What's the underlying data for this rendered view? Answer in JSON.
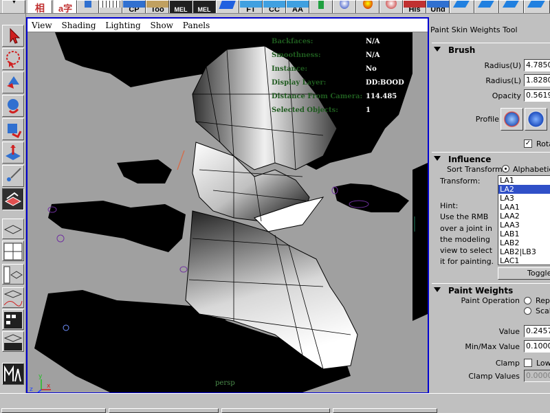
{
  "shelf": {
    "buttons": [
      {
        "label": "",
        "icon": "kanji-icon"
      },
      {
        "label": "",
        "icon": "kana-icon"
      },
      {
        "label": "",
        "icon": "pin-icon"
      },
      {
        "label": "",
        "icon": "grid-icon"
      },
      {
        "label": "CP",
        "icon": "cp-icon"
      },
      {
        "label": "Too",
        "icon": "tool-icon"
      },
      {
        "label": "",
        "icon": "mel-icon-1"
      },
      {
        "label": "",
        "icon": "mel-icon-2"
      },
      {
        "label": "",
        "icon": "blue-shape-icon"
      },
      {
        "label": "FT",
        "icon": "ft-icon"
      },
      {
        "label": "CC",
        "icon": "cc-icon"
      },
      {
        "label": "AA",
        "icon": "aa-icon"
      },
      {
        "label": "",
        "icon": "joint-icon"
      },
      {
        "label": "",
        "icon": "sphere-icon"
      },
      {
        "label": "",
        "icon": "paint-icon"
      },
      {
        "label": "",
        "icon": "red-sphere-icon"
      },
      {
        "label": "His",
        "icon": "history-icon"
      },
      {
        "label": "Und",
        "icon": "undo-icon"
      },
      {
        "label": "",
        "icon": "plane-icon-1"
      },
      {
        "label": "",
        "icon": "plane-icon-2"
      },
      {
        "label": "",
        "icon": "plane-icon-3"
      },
      {
        "label": "",
        "icon": "plane-icon-4"
      }
    ]
  },
  "viewport": {
    "menu": [
      "View",
      "Shading",
      "Lighting",
      "Show",
      "Panels"
    ],
    "hud": [
      {
        "key": "Backfaces:",
        "value": "N/A"
      },
      {
        "key": "Smoothness:",
        "value": "N/A"
      },
      {
        "key": "Instance:",
        "value": "No"
      },
      {
        "key": "Display Layer:",
        "value": "DD:BOOD"
      },
      {
        "key": "Distance From Camera:",
        "value": "114.485"
      },
      {
        "key": "Selected Objects:",
        "value": "1"
      }
    ],
    "camera": "persp",
    "axis": {
      "x": "x",
      "y": "y",
      "z": "z"
    }
  },
  "panel": {
    "title": "Paint Skin Weights Tool",
    "brush": {
      "header": "Brush",
      "radius_u_label": "Radius(U)",
      "radius_u": "4.7850",
      "radius_l_label": "Radius(L)",
      "radius_l": "1.8280",
      "opacity_label": "Opacity",
      "opacity": "0.5619",
      "profile_label": "Profile",
      "rotate_label": "Rota",
      "rotate_checked": true
    },
    "influence": {
      "header": "Influence",
      "sort_label": "Sort Transforms",
      "sort_option": "Alphabetica",
      "transform_label": "Transform:",
      "hint": [
        "Hint:",
        "Use the RMB",
        "over a joint in",
        "the modeling",
        "view to select",
        "it for painting."
      ],
      "items": [
        "LA1",
        "LA2",
        "LA3",
        "LAA1",
        "LAA2",
        "LAA3",
        "LAB1",
        "LAB2",
        "LAB2|LB3",
        "LAC1"
      ],
      "selected": "LA2",
      "toggle_label": "Toggle"
    },
    "paint_weights": {
      "header": "Paint Weights",
      "operation_label": "Paint Operation",
      "op_replace": "Rep",
      "op_scale": "Scal",
      "value_label": "Value",
      "value": "0.2457",
      "minmax_label": "Min/Max Value",
      "minmax": "0.1000",
      "clamp_label": "Clamp",
      "clamp_low": "Low",
      "clamp_values_label": "Clamp Values",
      "clamp_values": "0.0000"
    }
  },
  "colors": {
    "viewport_border": "#0000d0",
    "hud_key": "#1e5a1e",
    "selection": "#3050c8"
  }
}
